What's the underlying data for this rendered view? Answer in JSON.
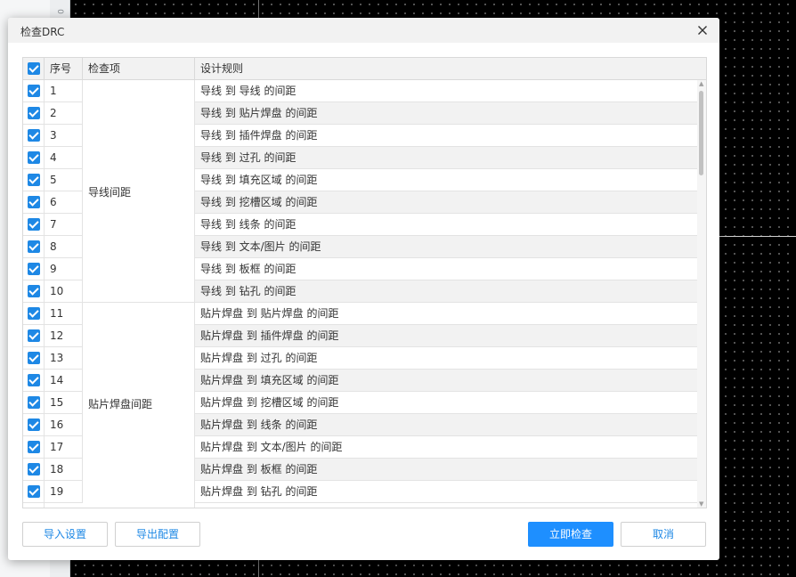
{
  "dialog": {
    "title": "检查DRC",
    "columns": {
      "no": "序号",
      "item": "检查项",
      "rule": "设计规则"
    },
    "groups": [
      {
        "label": "导线间距"
      },
      {
        "label": "贴片焊盘间距"
      }
    ],
    "rows": [
      {
        "no": "1",
        "rule": "导线 到 导线 的间距"
      },
      {
        "no": "2",
        "rule": "导线 到 贴片焊盘 的间距"
      },
      {
        "no": "3",
        "rule": "导线 到 插件焊盘 的间距"
      },
      {
        "no": "4",
        "rule": "导线 到 过孔 的间距"
      },
      {
        "no": "5",
        "rule": "导线 到 填充区域 的间距"
      },
      {
        "no": "6",
        "rule": "导线 到 挖槽区域 的间距"
      },
      {
        "no": "7",
        "rule": "导线 到 线条 的间距"
      },
      {
        "no": "8",
        "rule": "导线 到 文本/图片 的间距"
      },
      {
        "no": "9",
        "rule": "导线 到 板框 的间距"
      },
      {
        "no": "10",
        "rule": "导线 到 钻孔 的间距"
      },
      {
        "no": "11",
        "rule": "贴片焊盘 到 贴片焊盘 的间距"
      },
      {
        "no": "12",
        "rule": "贴片焊盘 到 插件焊盘 的间距"
      },
      {
        "no": "13",
        "rule": "贴片焊盘 到 过孔 的间距"
      },
      {
        "no": "14",
        "rule": "贴片焊盘 到 填充区域 的间距"
      },
      {
        "no": "15",
        "rule": "贴片焊盘 到 挖槽区域 的间距"
      },
      {
        "no": "16",
        "rule": "贴片焊盘 到 线条 的间距"
      },
      {
        "no": "17",
        "rule": "贴片焊盘 到 文本/图片 的间距"
      },
      {
        "no": "18",
        "rule": "贴片焊盘 到 板框 的间距"
      },
      {
        "no": "19",
        "rule": "贴片焊盘 到 钻孔 的间距"
      }
    ],
    "buttons": {
      "import": "导入设置",
      "export": "导出配置",
      "check": "立即检查",
      "cancel": "取消"
    }
  },
  "colors": {
    "accent": "#1e88e5",
    "primary_button": "#1e8fff",
    "header_bg": "#f2f2f2",
    "alt_row_bg": "#f2f2f2"
  },
  "icons": {
    "close": "close-icon",
    "checkbox": "checkbox-checked-icon"
  }
}
